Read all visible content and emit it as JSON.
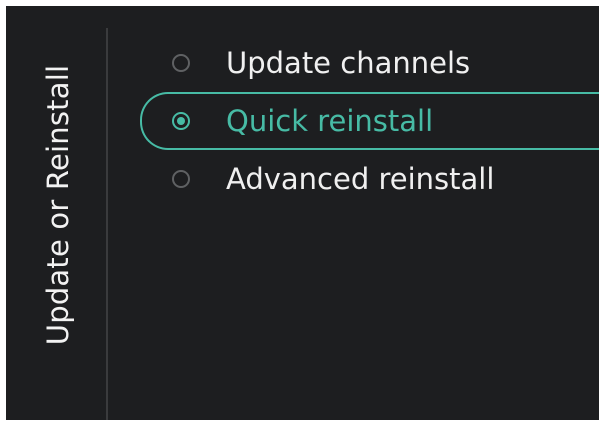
{
  "panel": {
    "title": "Update or Reinstall"
  },
  "options": [
    {
      "label": "Update channels",
      "selected": false
    },
    {
      "label": "Quick reinstall",
      "selected": true
    },
    {
      "label": "Advanced reinstall",
      "selected": false
    }
  ],
  "colors": {
    "background": "#1d1e20",
    "accent": "#47bba5",
    "text": "#f0f0f0",
    "radio_idle": "#5f6163"
  }
}
